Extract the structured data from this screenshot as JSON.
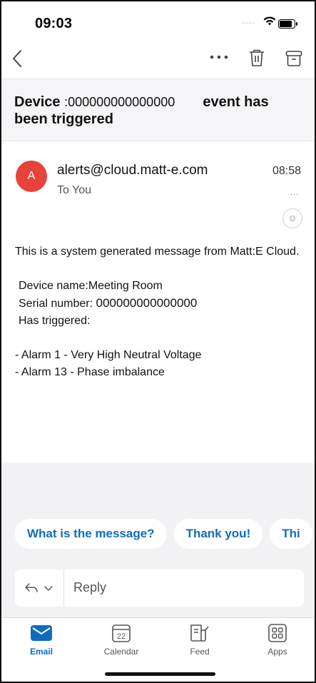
{
  "status_bar": {
    "time": "09:03",
    "signal_dots": "....."
  },
  "toolbar": {
    "back_icon": "chevron-left-icon",
    "more_icon": "more-horizontal-icon",
    "trash_icon": "trash-icon",
    "archive_icon": "archive-icon"
  },
  "message": {
    "subject_start": "Device ",
    "subject_redacted": ":000000000000000",
    "subject_end": "event has been triggered",
    "avatar_letter": "A",
    "avatar_color": "#e8433a",
    "sender": "alerts@cloud.matt-e.com",
    "to": "To You",
    "time": "08:58",
    "more": "...",
    "reaction_icon": "smiley-icon",
    "body": {
      "intro": "This is a system generated message from Matt:E Cloud.",
      "device_name": "Device name:Meeting Room",
      "serial_label": "Serial number: ",
      "serial_value": "000000000000000",
      "triggered": "Has triggered:",
      "alarm_1": "- Alarm 1 - Very High Neutral Voltage",
      "alarm_2": "- Alarm 13 - Phase imbalance"
    }
  },
  "suggestions": [
    "What is the message?",
    "Thank you!",
    "Thi"
  ],
  "reply": {
    "label": "Reply",
    "icon": "reply-arrow-icon"
  },
  "tabs": [
    {
      "label": "Email",
      "icon": "mail-icon",
      "active": true
    },
    {
      "label": "Calendar",
      "icon": "calendar-icon",
      "day": "22"
    },
    {
      "label": "Feed",
      "icon": "feed-icon"
    },
    {
      "label": "Apps",
      "icon": "apps-grid-icon"
    }
  ],
  "colors": {
    "accent": "#0f6cbd",
    "avatar": "#e8433a",
    "panel": "#f2f2f5"
  }
}
